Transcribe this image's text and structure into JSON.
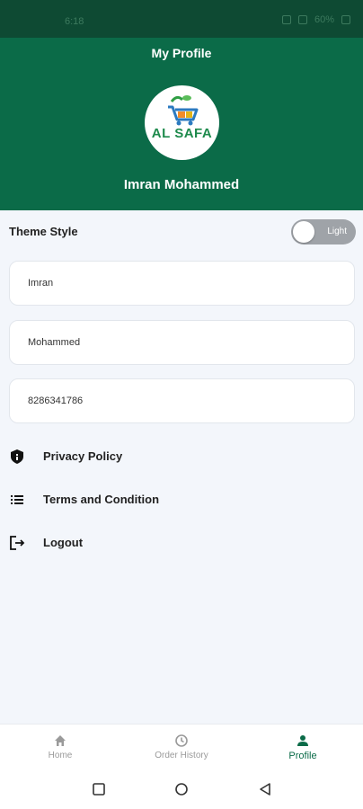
{
  "status_bar": {
    "time": "6:18",
    "battery": "60%"
  },
  "header": {
    "title": "My Profile",
    "brand_text": "AL SAFA",
    "user_name": "Imran Mohammed"
  },
  "theme": {
    "label": "Theme Style",
    "toggle_text": "Light"
  },
  "form": {
    "first_name": "Imran",
    "last_name": "Mohammed",
    "phone": "8286341786"
  },
  "menu": {
    "privacy": "Privacy Policy",
    "terms": "Terms and Condition",
    "logout": "Logout"
  },
  "bottom_nav": {
    "home": "Home",
    "order_history": "Order History",
    "profile": "Profile"
  },
  "colors": {
    "primary": "#0b6b48",
    "status_bar": "#0e4a33",
    "background": "#f3f6fb"
  },
  "icons": [
    "wifi-icon",
    "signal-icon",
    "battery-icon",
    "shield-icon",
    "list-icon",
    "logout-icon",
    "home-icon",
    "history-icon",
    "person-icon"
  ]
}
